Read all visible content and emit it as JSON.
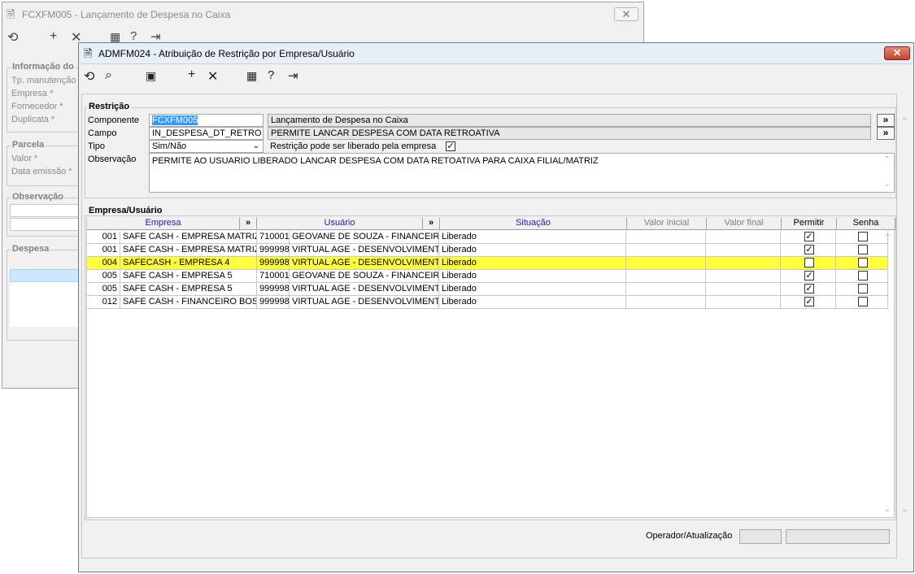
{
  "back_window": {
    "title": "FCXFM005 - Lançamento de Despesa no Caixa",
    "groups": {
      "info": {
        "label": "Informação do",
        "fields": [
          "Tp. manutenção",
          "Empresa *",
          "Fornecedor *",
          "Duplicata *"
        ]
      },
      "parcela": {
        "label": "Parcela",
        "fields": [
          "Valor *",
          "Data emissão *"
        ]
      },
      "observacao": {
        "label": "Observação"
      },
      "despesa": {
        "label": "Despesa"
      }
    }
  },
  "front_window": {
    "title": "ADMFM024 - Atribuição de Restrição por Empresa/Usuário",
    "restricao": {
      "label": "Restrição",
      "componente_label": "Componente",
      "componente_value": "FCXFM005",
      "componente_desc": "Lançamento de Despesa no Caixa",
      "campo_label": "Campo",
      "campo_value": "IN_DESPESA_DT_RETRO",
      "campo_desc": "PERMITE LANCAR DESPESA COM DATA RETROATIVA",
      "tipo_label": "Tipo",
      "tipo_value": "Sim/Não",
      "restricao_empresa_label": "Restrição pode ser liberado pela empresa",
      "restricao_empresa_checked": true,
      "observacao_label": "Observação",
      "observacao_value": "PERMITE AO USUARIO LIBERADO LANCAR DESPESA COM DATA RETOATIVA PARA CAIXA FILIAL/MATRIZ",
      "more_glyph": "»"
    },
    "empresa_usuario": {
      "label": "Empresa/Usuário",
      "columns": {
        "empresa": "Empresa",
        "usuario": "Usuário",
        "situacao": "Situação",
        "valor_inicial": "Valor inicial",
        "valor_final": "Valor final",
        "permitir": "Permitir",
        "senha": "Senha"
      },
      "rows": [
        {
          "emp_code": "001",
          "emp_name": "SAFE CASH - EMPRESA MATRIZ",
          "usr_code": "710001",
          "usr_name": "GEOVANE DE SOUZA - FINANCEIRO",
          "situacao": "Liberado",
          "permitir": true,
          "senha": false
        },
        {
          "emp_code": "001",
          "emp_name": "SAFE CASH - EMPRESA MATRIZ",
          "usr_code": "999998",
          "usr_name": "VIRTUAL AGE - DESENVOLVIMENTO",
          "situacao": "Liberado",
          "permitir": true,
          "senha": false
        },
        {
          "emp_code": "004",
          "emp_name": "SAFECASH - EMPRESA 4",
          "usr_code": "999998",
          "usr_name": "VIRTUAL AGE - DESENVOLVIMENTO",
          "situacao": "Liberado",
          "permitir": false,
          "senha": false,
          "highlight": true
        },
        {
          "emp_code": "005",
          "emp_name": "SAFE CASH - EMPRESA 5",
          "usr_code": "710001",
          "usr_name": "GEOVANE DE SOUZA - FINANCEIRO",
          "situacao": "Liberado",
          "permitir": true,
          "senha": false
        },
        {
          "emp_code": "005",
          "emp_name": "SAFE CASH - EMPRESA 5",
          "usr_code": "999998",
          "usr_name": "VIRTUAL AGE - DESENVOLVIMENTO",
          "situacao": "Liberado",
          "permitir": true,
          "senha": false
        },
        {
          "emp_code": "012",
          "emp_name": "SAFE CASH - FINANCEIRO BOSS",
          "usr_code": "999998",
          "usr_name": "VIRTUAL AGE - DESENVOLVIMENTO",
          "situacao": "Liberado",
          "permitir": true,
          "senha": false
        }
      ]
    },
    "footer": {
      "operador_label": "Operador/Atualização"
    }
  },
  "colors": {
    "highlight_row": "#ffff3c",
    "selected_text_bg": "#3399ff",
    "header_text_blue": "#1c1cb0"
  }
}
